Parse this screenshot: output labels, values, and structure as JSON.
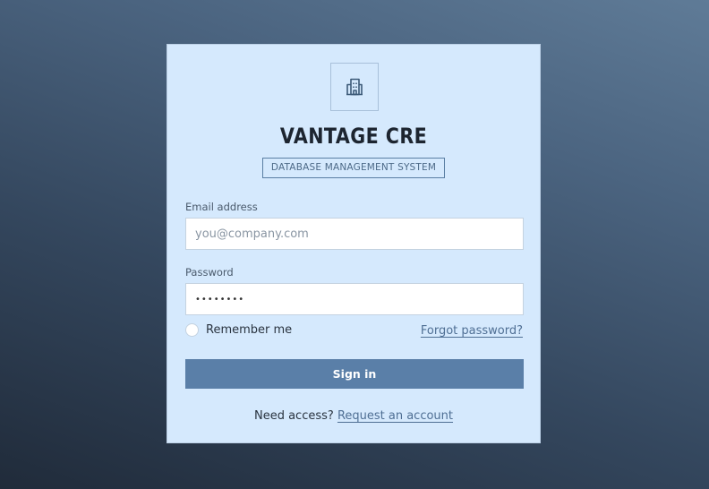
{
  "brand": {
    "title": "VANTAGE CRE",
    "subtitle": "DATABASE MANAGEMENT SYSTEM",
    "icon": "building-icon"
  },
  "form": {
    "email_label": "Email address",
    "email_placeholder": "you@company.com",
    "email_value": "",
    "password_label": "Password",
    "password_value": "••••••••",
    "remember_label": "Remember me",
    "remember_checked": false,
    "forgot_label": "Forgot password?",
    "signin_label": "Sign in"
  },
  "footer": {
    "prompt": "Need access?",
    "link_label": "Request an account"
  },
  "colors": {
    "card_bg": "#d5e9fd",
    "accent": "#5a7fa8",
    "link": "#4f6f94",
    "background_top": "#5f7b97",
    "background_bottom": "#202b3a"
  }
}
